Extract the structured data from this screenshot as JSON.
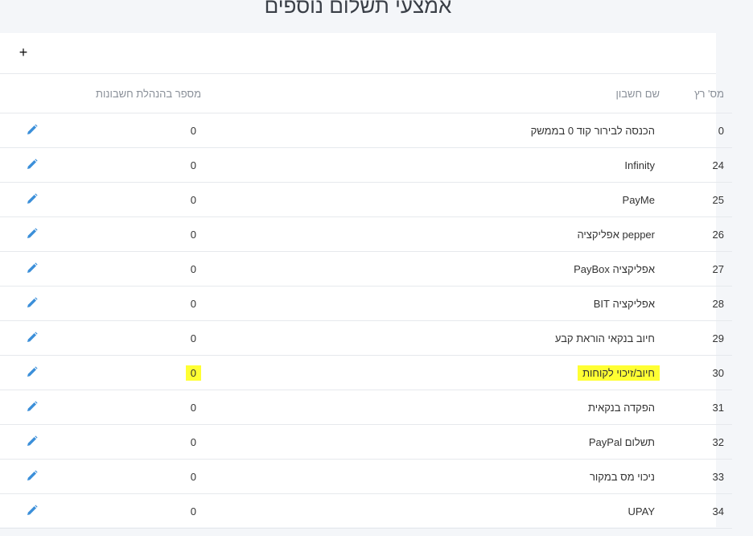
{
  "page": {
    "title": "אמצעי תשלום נוספים"
  },
  "toolbar": {
    "add_label": "+"
  },
  "columns": {
    "serial": "מס' רץ",
    "name": "שם חשבון",
    "accounting": "מספר בהנהלת חשבונות"
  },
  "colors": {
    "edit_icon": "#3b8fd9",
    "highlight": "#ffff33"
  },
  "rows": [
    {
      "serial": "0",
      "name": "הכנסה לבירור קוד 0 בממשק",
      "accounting": "0"
    },
    {
      "serial": "24",
      "name": "Infinity",
      "accounting": "0"
    },
    {
      "serial": "25",
      "name": "PayMe",
      "accounting": "0"
    },
    {
      "serial": "26",
      "name": "pepper אפליקציה",
      "accounting": "0"
    },
    {
      "serial": "27",
      "name": "אפליקציה PayBox",
      "accounting": "0"
    },
    {
      "serial": "28",
      "name": "אפליקציה BIT",
      "accounting": "0"
    },
    {
      "serial": "29",
      "name": "חיוב בנקאי הוראת קבע",
      "accounting": "0"
    },
    {
      "serial": "30",
      "name": "חיוב/זיכוי לקוחות",
      "accounting": "0",
      "highlight": true
    },
    {
      "serial": "31",
      "name": "הפקדה בנקאית",
      "accounting": "0"
    },
    {
      "serial": "32",
      "name": "תשלום PayPal",
      "accounting": "0"
    },
    {
      "serial": "33",
      "name": "ניכוי מס במקור",
      "accounting": "0"
    },
    {
      "serial": "34",
      "name": "UPAY",
      "accounting": "0"
    }
  ]
}
